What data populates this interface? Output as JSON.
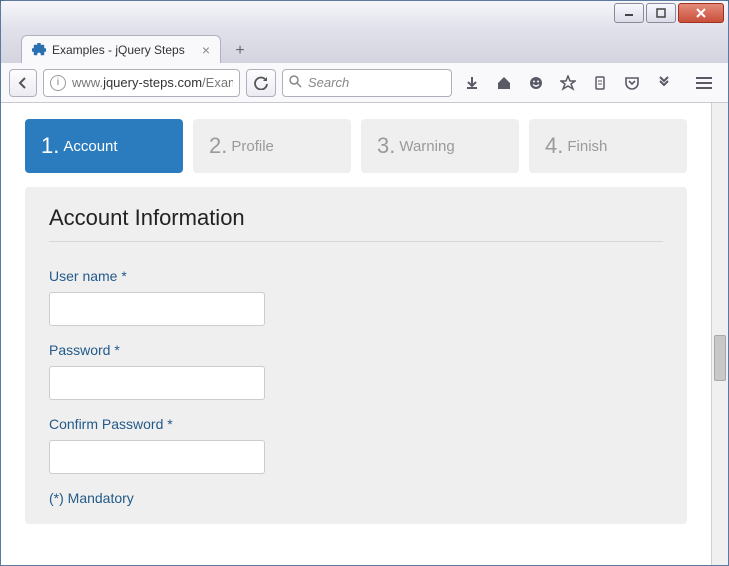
{
  "window": {
    "tab_title": "Examples - jQuery Steps"
  },
  "toolbar": {
    "url_prefix": "www.",
    "url_domain": "jquery-steps.com",
    "url_path": "/Example",
    "search_placeholder": "Search"
  },
  "wizard": {
    "steps": [
      {
        "num": "1.",
        "label": "Account",
        "active": true
      },
      {
        "num": "2.",
        "label": "Profile",
        "active": false
      },
      {
        "num": "3.",
        "label": "Warning",
        "active": false
      },
      {
        "num": "4.",
        "label": "Finish",
        "active": false
      }
    ],
    "panel_title": "Account Information",
    "fields": {
      "username_label": "User name *",
      "username_value": "",
      "password_label": "Password *",
      "password_value": "",
      "confirm_label": "Confirm Password *",
      "confirm_value": ""
    },
    "mandatory_note": "(*) Mandatory"
  }
}
